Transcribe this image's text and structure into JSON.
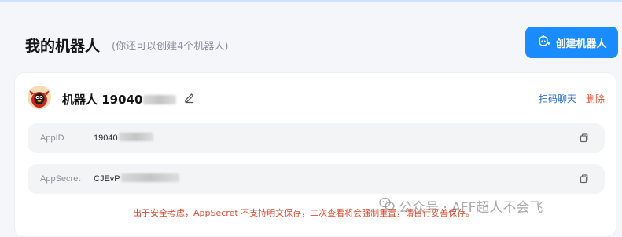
{
  "header": {
    "title": "我的机器人",
    "subtitle": "(你还可以创建4个机器人)",
    "create_button": "创建机器人",
    "create_icon": "robot-plus-icon"
  },
  "bot": {
    "name": "机器人 19040",
    "avatar": "qq-penguin-avatar",
    "actions": {
      "scan_chat": "扫码聊天",
      "delete": "删除"
    },
    "fields": [
      {
        "label": "AppID",
        "value": "19040"
      },
      {
        "label": "AppSecret",
        "value": "CJEvP"
      }
    ],
    "warning": "出于安全考虑，AppSecret 不支持明文保存，二次查看将会强制重置，请自行妥善保存。"
  },
  "watermark": {
    "text": "公众号 · AFF超人不会飞",
    "icon": "wechat-icon"
  },
  "colors": {
    "accent": "#1b8cff",
    "link": "#2b6fd6",
    "danger": "#e0492f",
    "background": "#f4f6fa"
  }
}
